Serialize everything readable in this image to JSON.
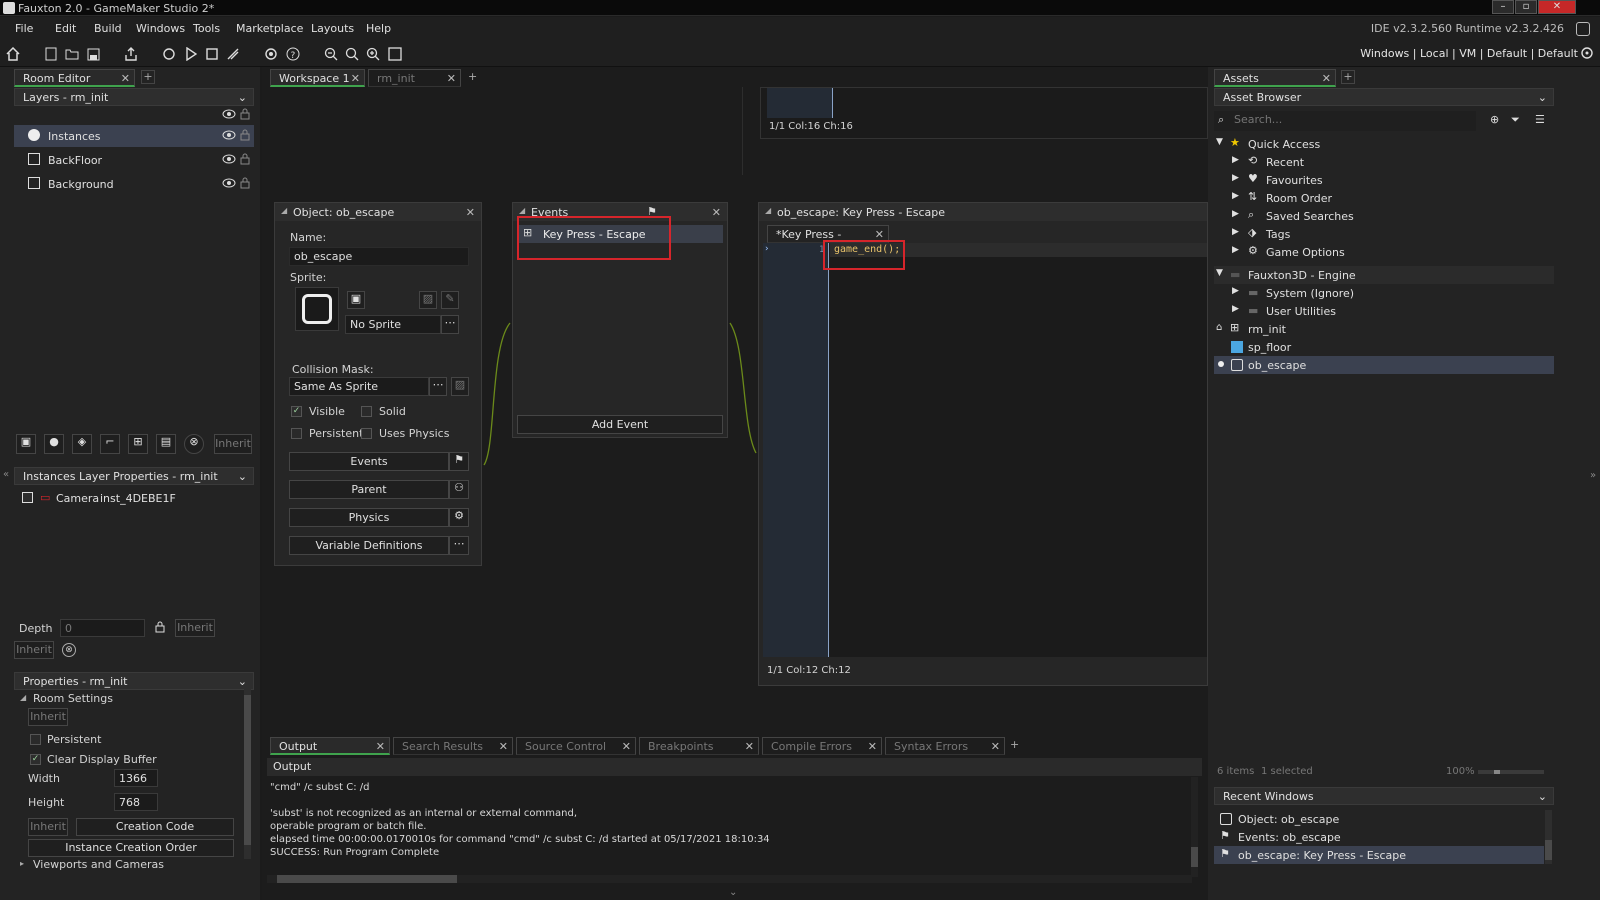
{
  "window": {
    "title": "Fauxton 2.0 - GameMaker Studio 2*"
  },
  "menu": [
    "File",
    "Edit",
    "Build",
    "Windows",
    "Tools",
    "Marketplace",
    "Layouts",
    "Help"
  ],
  "version_text": "IDE v2.3.2.560  Runtime v2.3.2.426",
  "toolbar": {
    "targets": "Windows  |  Local  |  VM  |  Default  |  Default"
  },
  "room_editor": {
    "tab": "Room Editor",
    "layers_title": "Layers - rm_init",
    "layers": [
      {
        "name": "Instances",
        "icon": "instance-layer-icon"
      },
      {
        "name": "BackFloor",
        "icon": "background-layer-icon"
      },
      {
        "name": "Background",
        "icon": "background-layer-icon"
      }
    ],
    "inherit": "Inherit",
    "layer_props_title": "Instances Layer Properties - rm_init",
    "camera": {
      "name": "Camera",
      "inst": "inst_4DEBE1F"
    },
    "depth_label": "Depth",
    "depth_value": "0",
    "properties_title": "Properties - rm_init",
    "room_settings": "Room Settings",
    "persistent": "Persistent",
    "clear_display_buffer": "Clear Display Buffer",
    "width_label": "Width",
    "width_value": "1366",
    "height_label": "Height",
    "height_value": "768",
    "creation_code": "Creation Code",
    "instance_creation_order": "Instance Creation Order",
    "viewports": "Viewports and Cameras"
  },
  "workspace": {
    "tabs": [
      "Workspace 1",
      "rm_init"
    ],
    "top_status": "1/1 Col:16 Ch:16"
  },
  "object": {
    "title": "Object: ob_escape",
    "name_label": "Name:",
    "name_value": "ob_escape",
    "sprite_label": "Sprite:",
    "sprite_value": "No Sprite",
    "collision_label": "Collision Mask:",
    "collision_value": "Same As Sprite",
    "visible": "Visible",
    "solid": "Solid",
    "persistent": "Persistent",
    "uses_physics": "Uses Physics",
    "buttons": [
      "Events",
      "Parent",
      "Physics",
      "Variable Definitions"
    ]
  },
  "events": {
    "title": "Events",
    "item": "Key Press - Escape",
    "add": "Add Event"
  },
  "code": {
    "title": "ob_escape: Key Press - Escape",
    "tab": "*Key Press - Escape",
    "line_no": "1",
    "line": "game_end();",
    "status": "1/1 Col:12 Ch:12"
  },
  "output": {
    "tabs": [
      "Output",
      "Search Results",
      "Source Control",
      "Breakpoints",
      "Compile Errors",
      "Syntax Errors"
    ],
    "header": "Output",
    "lines": [
      "\"cmd\"  /c subst C: /d",
      "",
      "'subst' is not recognized as an internal or external command,",
      "operable program or batch file.",
      "elapsed time 00:00:00.0170010s for command \"cmd\" /c subst C: /d started at 05/17/2021 18:10:34",
      "SUCCESS: Run Program Complete"
    ]
  },
  "assets": {
    "tab": "Assets",
    "browser": "Asset Browser",
    "search_placeholder": "Search...",
    "quick_access": "Quick Access",
    "quick_items": [
      {
        "label": "Recent",
        "icon": "history-icon"
      },
      {
        "label": "Favourites",
        "icon": "heart-icon"
      },
      {
        "label": "Room Order",
        "icon": "room-order-icon"
      },
      {
        "label": "Saved Searches",
        "icon": "search-icon"
      },
      {
        "label": "Tags",
        "icon": "tag-icon"
      },
      {
        "label": "Game Options",
        "icon": "gear-icon"
      }
    ],
    "engine_folder": "Fauxton3D - Engine",
    "engine_items": [
      "System (Ignore)",
      "User Utilities"
    ],
    "root_items": [
      "rm_init",
      "sp_floor",
      "ob_escape"
    ],
    "status_items": "6 items",
    "status_selected": "1 selected",
    "zoom": "100%",
    "recent_title": "Recent Windows",
    "recent": [
      "Object: ob_escape",
      "Events: ob_escape",
      "ob_escape: Key Press - Escape"
    ]
  },
  "colors": {
    "accent_green": "#3fa34d",
    "highlight_red": "#d6252b",
    "selection": "#3b4150",
    "code_yellow": "#e8c36a"
  }
}
